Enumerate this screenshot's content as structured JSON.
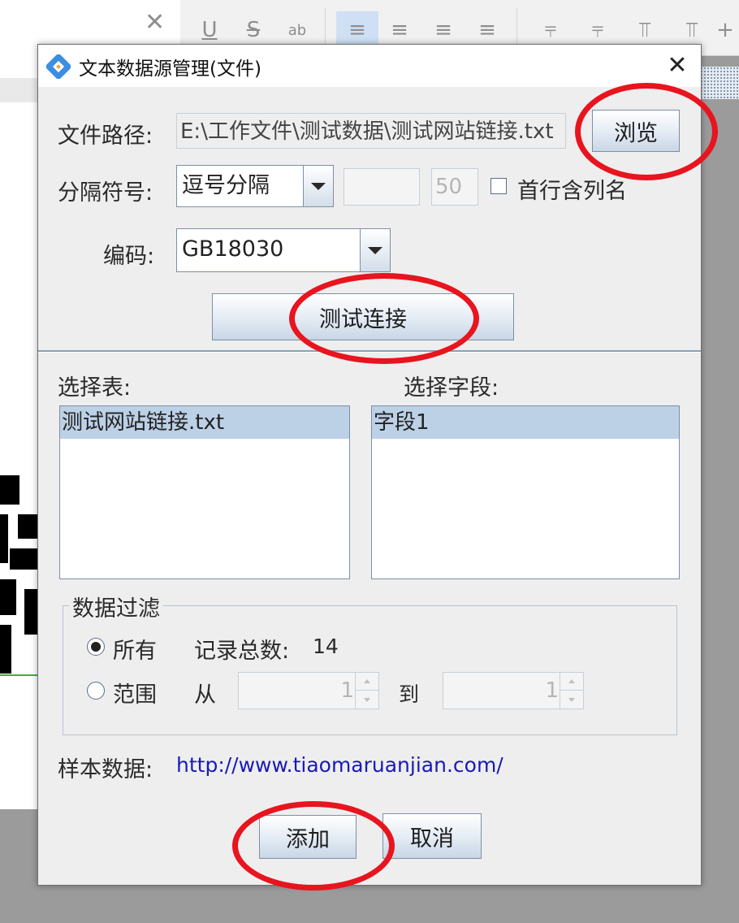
{
  "background": {
    "close_glyph": "✕",
    "toolbar": [
      {
        "icon": "underline-icon",
        "glyph": "U"
      },
      {
        "icon": "strikethrough-icon",
        "glyph": "S"
      },
      {
        "icon": "phonetic-icon",
        "glyph": "ab"
      },
      {
        "icon": "align-left-icon",
        "glyph": "≡",
        "active": true
      },
      {
        "icon": "align-center-icon",
        "glyph": "≡"
      },
      {
        "icon": "align-right-icon",
        "glyph": "≡"
      },
      {
        "icon": "align-justify-icon",
        "glyph": "≡"
      },
      {
        "icon": "distribute-left-icon",
        "glyph": "⫧"
      },
      {
        "icon": "distribute-right-icon",
        "glyph": "⫧"
      },
      {
        "icon": "distribute-top-icon",
        "glyph": "⫪"
      },
      {
        "icon": "distribute-bottom-icon",
        "glyph": "⫪"
      },
      {
        "icon": "more-icon",
        "glyph": "+"
      }
    ]
  },
  "dialog": {
    "title": "文本数据源管理(文件)",
    "close_glyph": "✕",
    "file_path": {
      "label": "文件路径:",
      "value": "E:\\工作文件\\测试数据\\测试网站链接.txt",
      "browse_label": "浏览"
    },
    "delimiter": {
      "label": "分隔符号:",
      "selected": "逗号分隔",
      "custom_value": "",
      "number_value": "50",
      "header_checkbox_label": "首行含列名",
      "header_checked": false
    },
    "encoding": {
      "label": "编码:",
      "selected": "GB18030"
    },
    "test_connection_label": "测试连接",
    "tables": {
      "label": "选择表:",
      "items": [
        "测试网站链接.txt"
      ]
    },
    "fields": {
      "label": "选择字段:",
      "items": [
        "字段1"
      ]
    },
    "filter": {
      "legend": "数据过滤",
      "all_label": "所有",
      "all_selected": true,
      "total_label": "记录总数:",
      "total_value": "14",
      "range_label": "范围",
      "from_label": "从",
      "from_value": "1",
      "to_label": "到",
      "to_value": "1"
    },
    "sample": {
      "label": "样本数据:",
      "value": "http://www.tiaomaruanjian.com/"
    },
    "add_label": "添加",
    "cancel_label": "取消"
  },
  "colors": {
    "annotation_red": "#e8141e",
    "selection_blue": "#bcd0e6",
    "link_blue": "#1a1ab8"
  }
}
